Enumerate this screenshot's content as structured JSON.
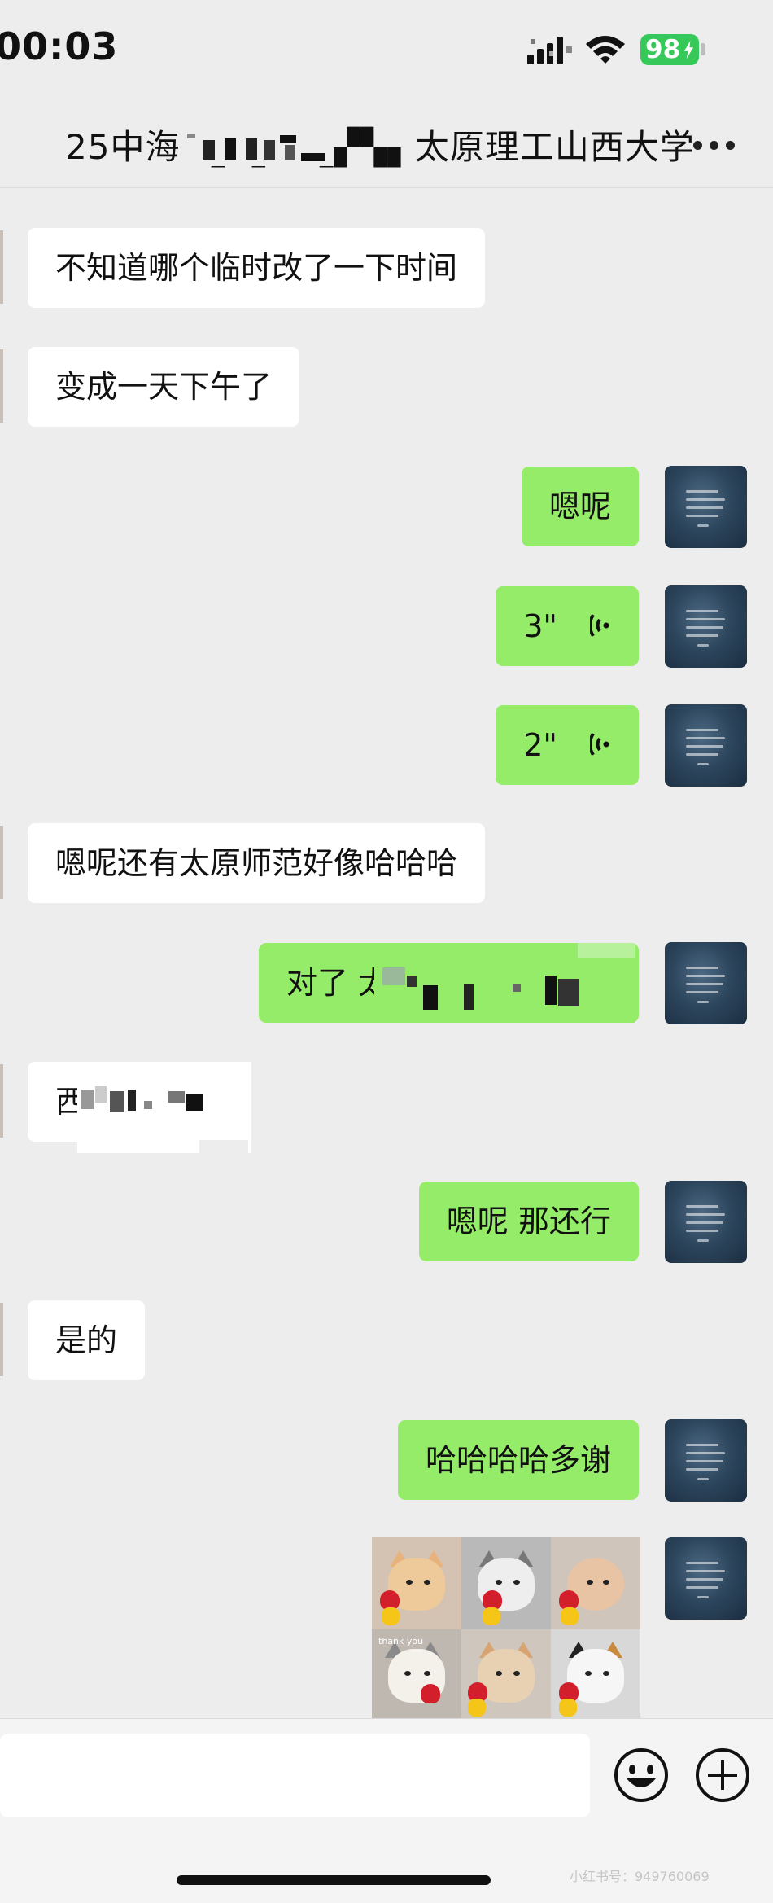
{
  "status_bar": {
    "time": "00:03",
    "battery": "98"
  },
  "header": {
    "title": "25中海ˇ▚▝▖▘▗▞▚▖太原理工山西大学",
    "more_icon": "more-dots-icon"
  },
  "messages": [
    {
      "side": "left",
      "text": "不知道哪个临时改了一下时间"
    },
    {
      "side": "left",
      "text": "变成一天下午了"
    },
    {
      "side": "right",
      "text": "嗯呢"
    },
    {
      "side": "right",
      "type": "voice",
      "duration": "3\""
    },
    {
      "side": "right",
      "type": "voice",
      "duration": "2\""
    },
    {
      "side": "left",
      "text": "嗯呢还有太原师范好像哈哈哈"
    },
    {
      "side": "right",
      "text": "对了 太理"
    },
    {
      "side": "left",
      "text": "西"
    },
    {
      "side": "right",
      "text": "嗯呢 那还行"
    },
    {
      "side": "left",
      "text": "是的"
    },
    {
      "side": "right",
      "text": "哈哈哈哈多谢"
    },
    {
      "side": "right",
      "type": "sticker",
      "caption": "thank you"
    }
  ],
  "input_bar": {
    "emoji_icon": "smiley-icon",
    "plus_icon": "plus-circle-icon"
  },
  "watermark": "小红书号：949760069",
  "colors": {
    "background": "#ededed",
    "bubble_right": "#95ec69",
    "bubble_left": "#ffffff",
    "battery": "#36c95a"
  }
}
